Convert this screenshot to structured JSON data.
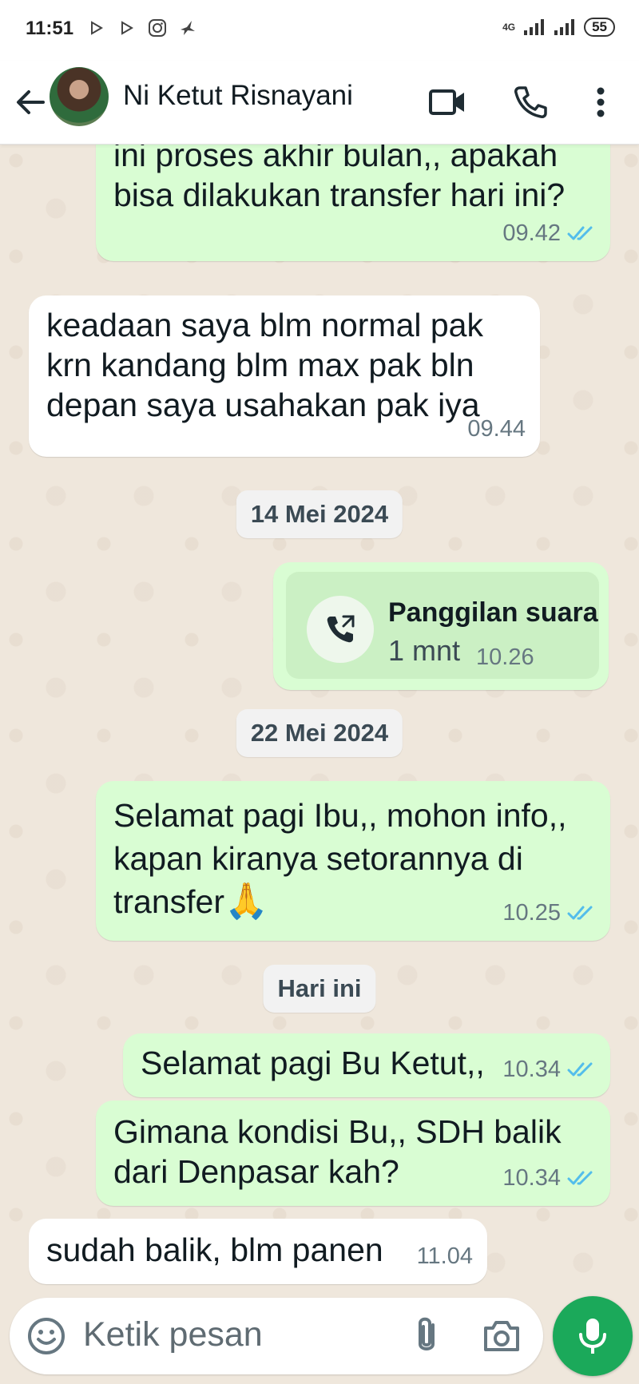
{
  "status_bar": {
    "time": "11:51",
    "network": "4G",
    "battery": "55",
    "left_icons": [
      "play-icon",
      "play-icon",
      "instagram-icon",
      "bird-icon"
    ]
  },
  "header": {
    "contact_name": "Ni Ketut Risnayani",
    "icons": [
      "back-arrow-icon",
      "video-call-icon",
      "phone-icon",
      "more-vert-icon"
    ]
  },
  "messages": [
    {
      "dir": "out",
      "text": "ini proses akhir bulan,,  apakah\nbisa dilakukan transfer hari ini?",
      "time": "09.42",
      "read": true
    },
    {
      "dir": "in",
      "text": "keadaan saya blm normal pak\nkrn kandang blm max pak bln\ndepan saya usahakan pak iya",
      "time": "09.44"
    },
    {
      "dir": "date",
      "text": "14 Mei 2024"
    },
    {
      "dir": "call",
      "title": "Panggilan suara",
      "duration": "1 mnt",
      "time": "10.26"
    },
    {
      "dir": "date",
      "text": "22 Mei 2024"
    },
    {
      "dir": "out",
      "text": "Selamat pagi Ibu,, mohon info,,\nkapan kiranya setorannya di\ntransfer",
      "emoji": "🙏",
      "time": "10.25",
      "read": true
    },
    {
      "dir": "date",
      "text": "Hari ini"
    },
    {
      "dir": "out",
      "text": "Selamat pagi Bu Ketut,,",
      "time": "10.34",
      "read": true
    },
    {
      "dir": "out",
      "text": "Gimana kondisi Bu,, SDH balik\ndari Denpasar kah?",
      "time": "10.34",
      "read": true
    },
    {
      "dir": "in",
      "text": "sudah balik, blm panen",
      "time": "11.04"
    }
  ],
  "composer": {
    "placeholder": "Ketik pesan",
    "icons": [
      "emoji-icon",
      "attach-icon",
      "camera-icon",
      "mic-icon"
    ]
  },
  "colors": {
    "outgoing_bubble": "#d9fdd3",
    "incoming_bubble": "#ffffff",
    "read_ticks": "#53bdeb",
    "mic_button": "#1ba95a",
    "chat_bg": "#efe7dc"
  }
}
